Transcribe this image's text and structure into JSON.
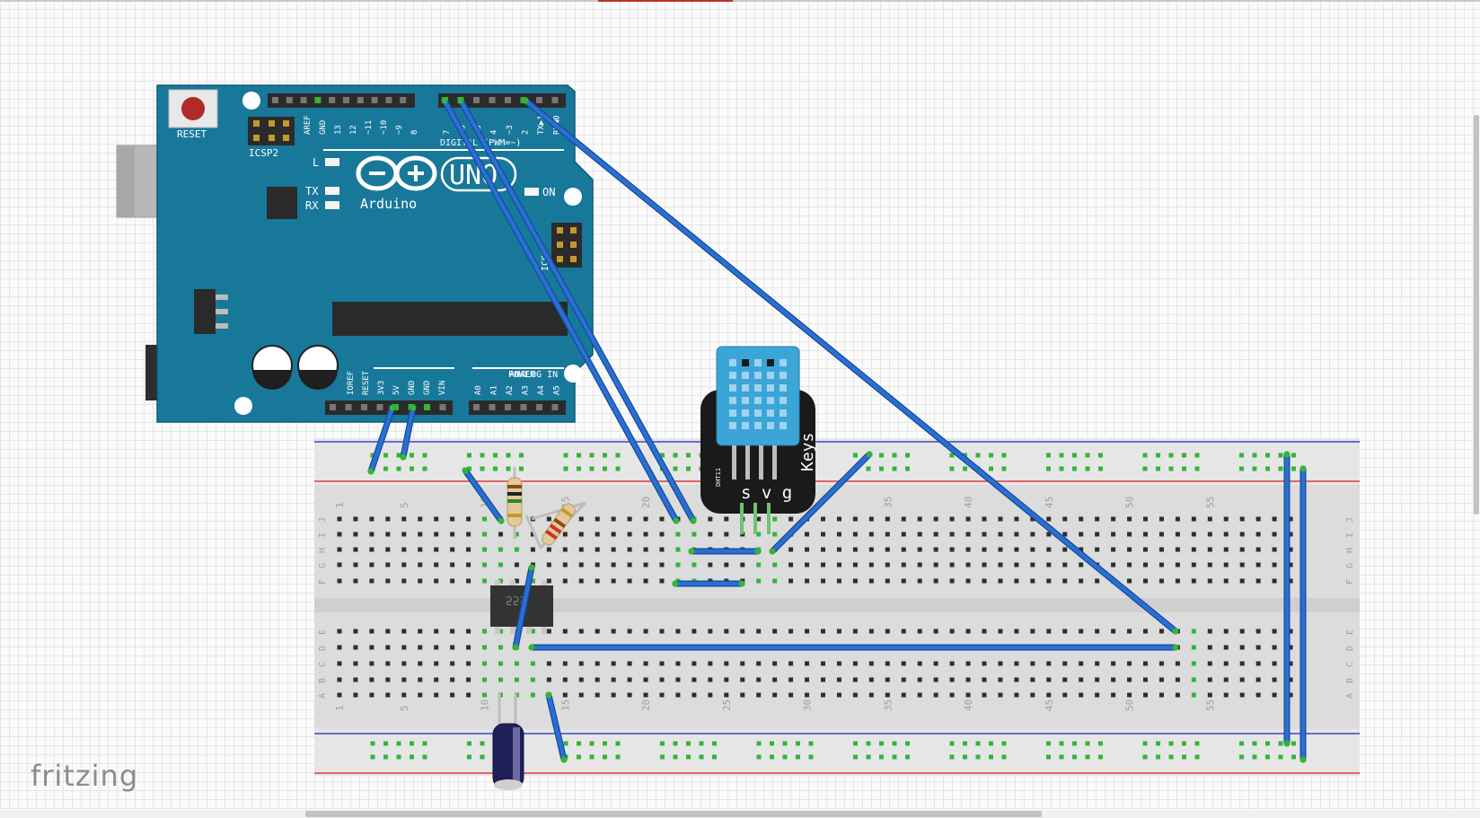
{
  "app": {
    "watermark": "fritzing"
  },
  "arduino": {
    "reset_label": "RESET",
    "icsp2_label": "ICSP2",
    "icsp_label": "ICSP",
    "brand": "Arduino",
    "model": "UNO",
    "l_led": "L",
    "tx_led": "TX",
    "rx_led": "RX",
    "on_led": "ON",
    "digital_header": "DIGITAL (PWM=~)",
    "power_header": "POWER",
    "analog_header": "ANALOG IN",
    "top_pins_left": [
      "AREF",
      "GND",
      "13",
      "12",
      "~11",
      "~10",
      "~9",
      "8"
    ],
    "top_pins_right": [
      "7",
      "~6",
      "~5",
      "4",
      "~3",
      "2",
      "TX▶1",
      "RX◀0"
    ],
    "power_pins": [
      "IOREF",
      "RESET",
      "3V3",
      "5V",
      "GND",
      "GND",
      "VIN"
    ],
    "analog_pins": [
      "A0",
      "A1",
      "A2",
      "A3",
      "A4",
      "A5"
    ]
  },
  "breadboard": {
    "column_numbers": [
      "1",
      "5",
      "10",
      "15",
      "20",
      "25",
      "30",
      "35",
      "40",
      "45",
      "50",
      "55"
    ],
    "row_letters_top": [
      "J",
      "I",
      "H",
      "G",
      "F"
    ],
    "row_letters_bottom": [
      "E",
      "D",
      "C",
      "B",
      "A"
    ]
  },
  "dht_sensor": {
    "brand": "Keys",
    "pins": "s v g",
    "model": "DHT11"
  },
  "timer_chip": {
    "label": "555"
  },
  "colors": {
    "board": "#17789a",
    "wire": "#2a6fd1",
    "wire_edge": "#134c9c",
    "sensor": "#3ba5d8",
    "rail_red": "#e03b3b",
    "rail_blue": "#3b46c8"
  }
}
